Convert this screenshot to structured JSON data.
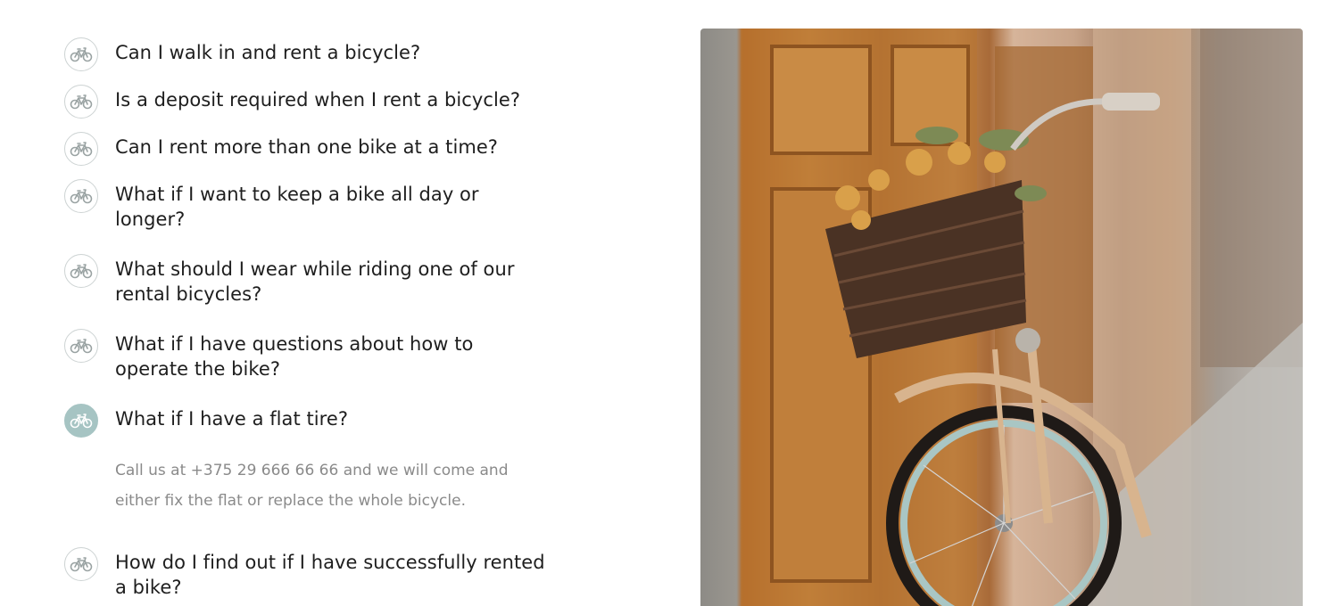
{
  "faq": {
    "items": [
      {
        "question": "Can I walk in and rent a bicycle?",
        "icon": "bicycle-icon",
        "active": false
      },
      {
        "question": "Is a deposit required when I rent a bicycle?",
        "icon": "bicycle-icon",
        "active": false
      },
      {
        "question": "Can I rent more than one bike at a time?",
        "icon": "bicycle-icon",
        "active": false
      },
      {
        "question": "What if I want to keep a bike all day or longer?",
        "icon": "bicycle-icon",
        "active": false
      },
      {
        "question": "What should I wear while riding one of our rental bicycles?",
        "icon": "bicycle-icon",
        "active": false
      },
      {
        "question": "What if I have questions about how to operate the bike?",
        "icon": "bicycle-icon",
        "active": false
      },
      {
        "question": "What if I have a flat tire?",
        "icon": "bicycle-icon",
        "active": true,
        "answer": "Call us at +375 29 666 66 66 and we will come and either fix the flat or replace the whole bicycle."
      },
      {
        "question": "How do I find out if I have successfully rented a bike?",
        "icon": "bicycle-icon",
        "active": false
      }
    ]
  },
  "colors": {
    "active_icon_bg": "#a6c4c3",
    "question_text": "#1e1e1e",
    "answer_text": "#8a8a8a"
  },
  "image": {
    "icon": "bicycle-with-basket-photo"
  }
}
